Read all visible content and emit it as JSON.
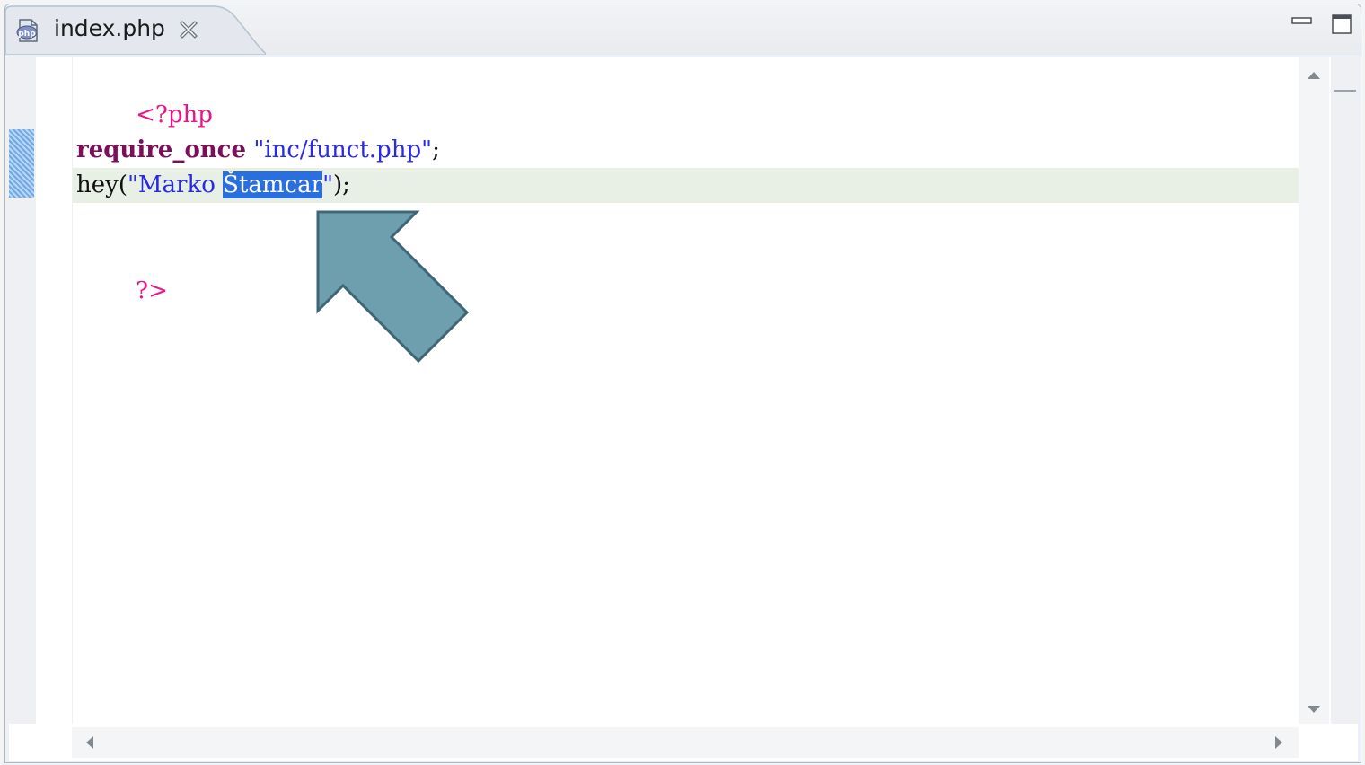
{
  "tab": {
    "icon": "php-file-icon",
    "label": "index.php",
    "close_icon": "close-x-icon"
  },
  "window_controls": {
    "minimize_icon": "minimize-icon",
    "maximize_icon": "maximize-icon"
  },
  "code": {
    "open_tag": "<?php",
    "line3_keyword": "require_once",
    "line3_space": " ",
    "line3_string": "\"inc/funct.php\"",
    "line3_end": ";",
    "line4_func": "hey(",
    "line4_string_a": "\"Marko ",
    "line4_selected": "Štamcar",
    "line4_string_b": "\"",
    "line4_end": ");",
    "close_tag": "?>"
  },
  "colors": {
    "php_tag": "#ee1288",
    "keyword": "#7b0f5a",
    "string": "#2a2ae6",
    "selection": "#2a6fe0",
    "current_line": "#e8f0e6",
    "annotation_arrow": "#6e9fae"
  },
  "annotation": {
    "icon": "pointer-arrow-icon"
  }
}
